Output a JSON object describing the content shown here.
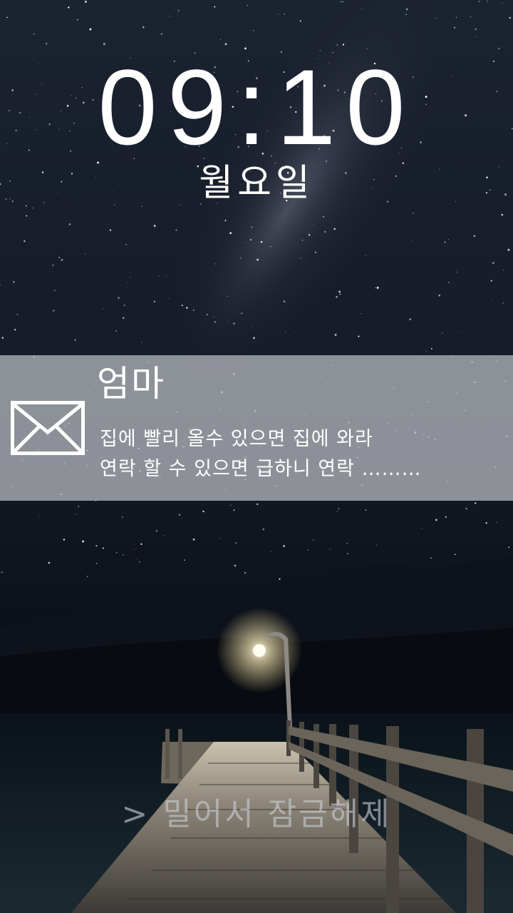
{
  "lockscreen": {
    "time": "09:10",
    "weekday": "월요일"
  },
  "notification": {
    "icon": "envelope-icon",
    "sender": "엄마",
    "message_lines": [
      "집에 빨리 올수 있으면 집에 와라",
      "연락 할 수 있으면 급하니 연락 ………"
    ]
  },
  "unlock": {
    "icon": "chevron-right-icon",
    "chevron": ">",
    "label": "밀어서 잠금해제"
  },
  "colors": {
    "notification_bg": "#b0b2b8",
    "text": "#ffffff",
    "sky_top": "#1a2230",
    "sky_bottom": "#05070c"
  }
}
